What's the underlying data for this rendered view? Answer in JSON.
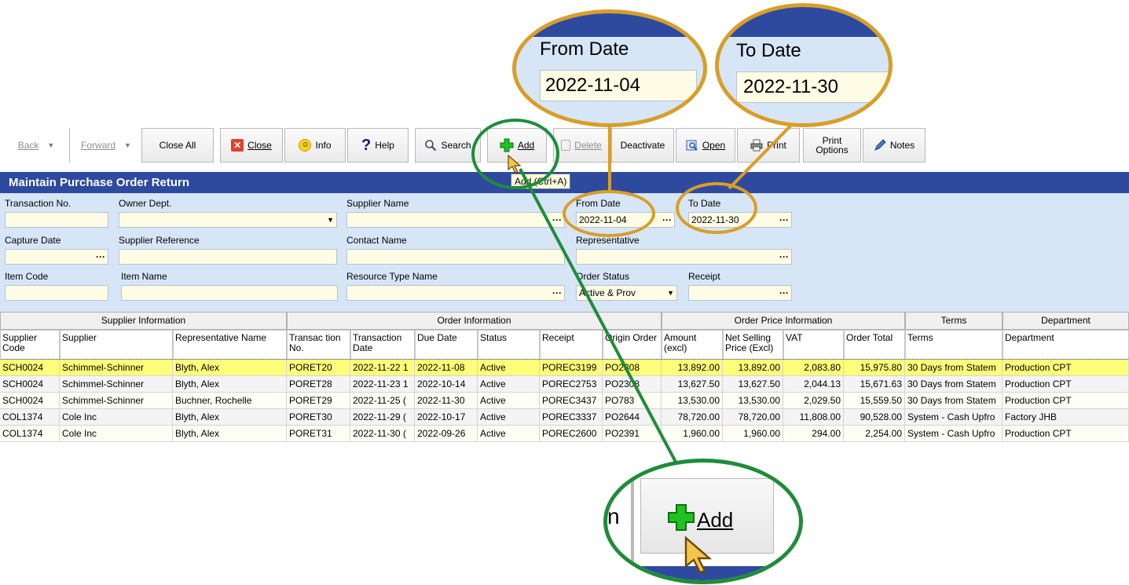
{
  "toolbar": {
    "back": "Back",
    "forward": "Forward",
    "close_all": "Close All",
    "close": "Close",
    "info": "Info",
    "help": "Help",
    "search": "Search",
    "add": "Add",
    "delete": "Delete",
    "deactivate": "Deactivate",
    "open": "Open",
    "print": "Print",
    "print_options_1": "Print",
    "print_options_2": "Options",
    "notes": "Notes"
  },
  "tooltip": "Add (Ctrl+A)",
  "title": "Maintain Purchase Order Return",
  "filters": {
    "transaction_no": {
      "label": "Transaction No.",
      "value": ""
    },
    "owner_dept": {
      "label": "Owner Dept.",
      "value": ""
    },
    "supplier_name": {
      "label": "Supplier Name",
      "value": ""
    },
    "from_date": {
      "label": "From Date",
      "value": "2022-11-04"
    },
    "to_date": {
      "label": "To Date",
      "value": "2022-11-30"
    },
    "capture_date": {
      "label": "Capture Date",
      "value": ""
    },
    "supplier_reference": {
      "label": "Supplier Reference",
      "value": ""
    },
    "contact_name": {
      "label": "Contact Name",
      "value": ""
    },
    "representative": {
      "label": "Representative",
      "value": ""
    },
    "item_code": {
      "label": "Item Code",
      "value": ""
    },
    "item_name": {
      "label": "Item Name",
      "value": ""
    },
    "resource_type_name": {
      "label": "Resource Type Name",
      "value": ""
    },
    "order_status": {
      "label": "Order Status",
      "value": "Active & Prov"
    },
    "receipt": {
      "label": "Receipt",
      "value": ""
    }
  },
  "grid": {
    "groups": [
      "Supplier Information",
      "Order Information",
      "Order Price Information",
      "Terms",
      "Department"
    ],
    "columns": [
      "Supplier Code",
      "Supplier",
      "Representative Name",
      "Transac tion No.",
      "Transaction Date",
      "Due Date",
      "Status",
      "Receipt",
      "Origin Order",
      "Amount (excl)",
      "Net Selling Price (Excl)",
      "VAT",
      "Order Total",
      "Terms",
      "Department"
    ],
    "rows": [
      [
        "SCH0024",
        "Schimmel-Schinner",
        "Blyth, Alex",
        "PORET20",
        "2022-11-22 1",
        "2022-11-08",
        "Active",
        "POREC3199",
        "PO2308",
        "13,892.00",
        "13,892.00",
        "2,083.80",
        "15,975.80",
        "30 Days from Statem",
        "Production CPT"
      ],
      [
        "SCH0024",
        "Schimmel-Schinner",
        "Blyth, Alex",
        "PORET28",
        "2022-11-23 1",
        "2022-10-14",
        "Active",
        "POREC2753",
        "PO2308",
        "13,627.50",
        "13,627.50",
        "2,044.13",
        "15,671.63",
        "30 Days from Statem",
        "Production CPT"
      ],
      [
        "SCH0024",
        "Schimmel-Schinner",
        "Buchner, Rochelle",
        "PORET29",
        "2022-11-25 (",
        "2022-11-30",
        "Active",
        "POREC3437",
        "PO783",
        "13,530.00",
        "13,530.00",
        "2,029.50",
        "15,559.50",
        "30 Days from Statem",
        "Production CPT"
      ],
      [
        "COL1374",
        "Cole Inc",
        "Blyth, Alex",
        "PORET30",
        "2022-11-29 (",
        "2022-10-17",
        "Active",
        "POREC3337",
        "PO2644",
        "78,720.00",
        "78,720.00",
        "11,808.00",
        "90,528.00",
        "System - Cash Upfro",
        "Factory JHB"
      ],
      [
        "COL1374",
        "Cole Inc",
        "Blyth, Alex",
        "PORET31",
        "2022-11-30 (",
        "2022-09-26",
        "Active",
        "POREC2600",
        "PO2391",
        "1,960.00",
        "1,960.00",
        "294.00",
        "2,254.00",
        "System - Cash Upfro",
        "Production CPT"
      ]
    ]
  },
  "zoom": {
    "from_label": "From Date",
    "from_value": "2022-11-04",
    "to_label": "To Date",
    "to_value": "2022-11-30",
    "add_label": "Add",
    "search_fragment": "n"
  },
  "colors": {
    "title_bar": "#2d4a9e",
    "filter_bg": "#d6e6f7",
    "input_bg": "#fffce6",
    "selected_row": "#fffe7a",
    "callout_orange": "#d89e28",
    "callout_green": "#1f8c3a"
  }
}
